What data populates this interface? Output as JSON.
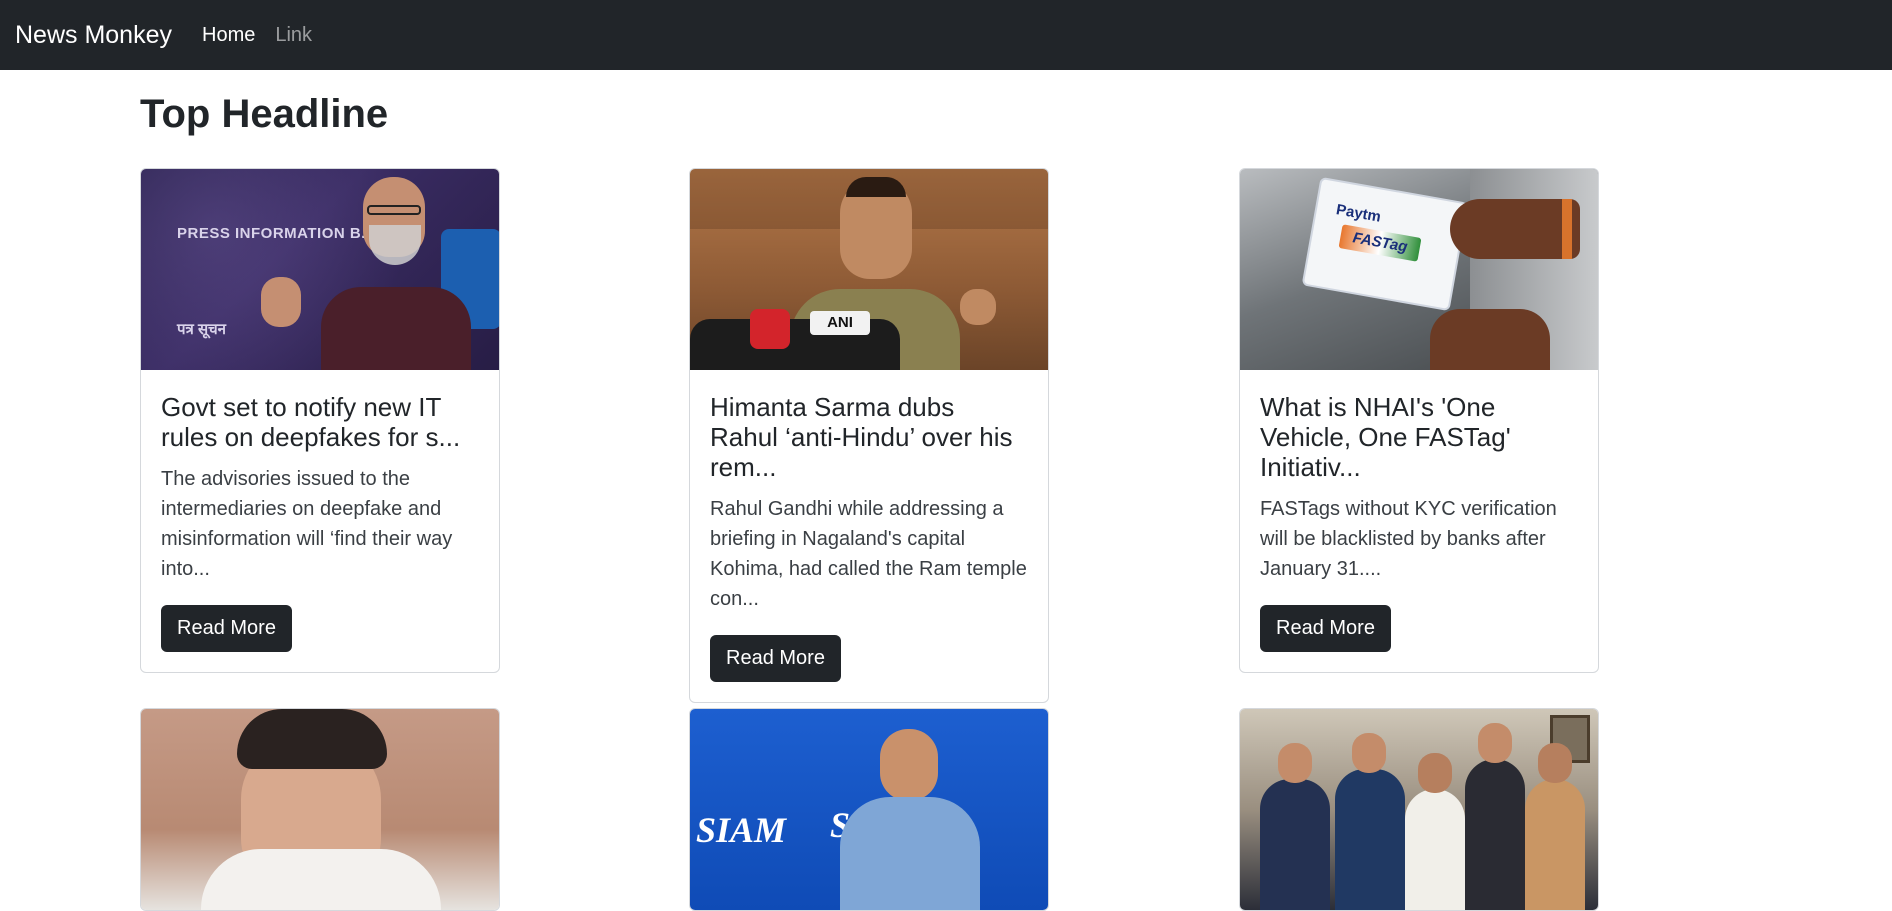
{
  "navbar": {
    "brand": "News Monkey",
    "links": [
      {
        "label": "Home",
        "active": true
      },
      {
        "label": "Link",
        "active": false
      }
    ]
  },
  "page": {
    "title": "Top Headline"
  },
  "cards": [
    {
      "title": "Govt set to notify new IT rules on deepfakes for s...",
      "description": "The advisories issued to the intermediaries on deepfake and misinformation will ‘find their way into...",
      "button": "Read More",
      "image_texts": [
        "PRESS INFORMATION B...AU",
        "पत्र सूचन"
      ]
    },
    {
      "title": "Himanta Sarma dubs Rahul ‘anti-Hindu’ over his rem...",
      "description": "Rahul Gandhi while addressing a briefing in Nagaland's capital Kohima, had called the Ram temple con...",
      "button": "Read More",
      "image_texts": [
        "ANI"
      ]
    },
    {
      "title": "What is NHAI's 'One Vehicle, One FASTag' Initiativ...",
      "description": "FASTags without KYC verification will be blacklisted by banks after January 31....",
      "button": "Read More",
      "image_texts": [
        "Paytm",
        "FASTag"
      ]
    },
    {
      "image_texts": []
    },
    {
      "image_texts": [
        "SIAM",
        "SIA"
      ]
    },
    {
      "image_texts": []
    }
  ]
}
